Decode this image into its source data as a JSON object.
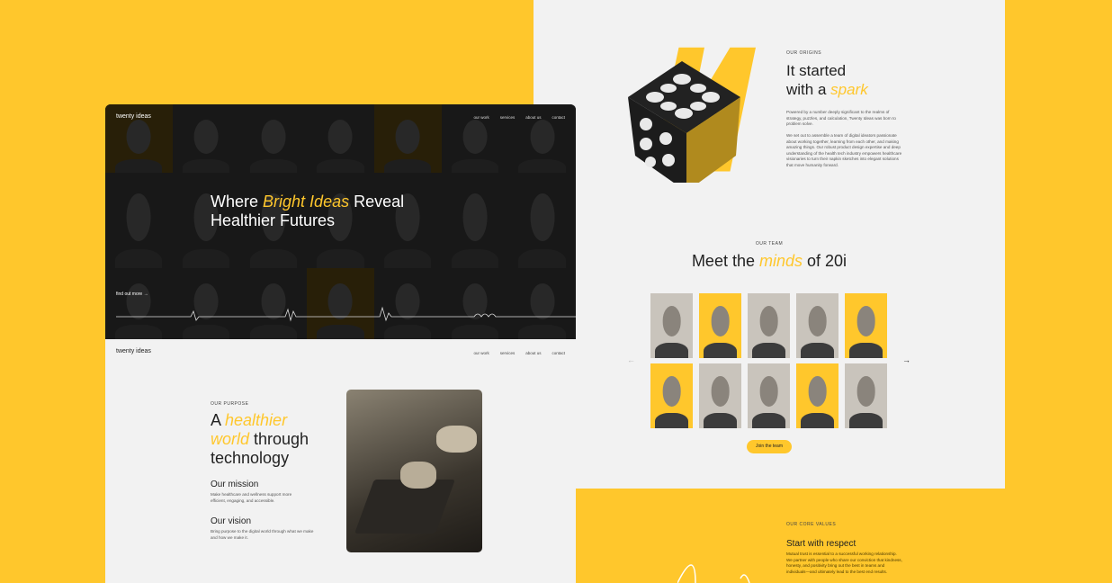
{
  "hero": {
    "logo": "twenty ideas",
    "nav": [
      "our work",
      "services",
      "about us",
      "contact"
    ],
    "title_pre": "Where ",
    "title_accent": "Bright Ideas",
    "title_post": " Reveal",
    "title_line2": "Healthier Futures",
    "cta": "find out more",
    "cta_icon": "arrow-right-icon"
  },
  "purpose": {
    "logo": "twenty ideas",
    "nav": [
      "our work",
      "services",
      "about us",
      "contact"
    ],
    "eyebrow": "OUR PURPOSE",
    "h_pre": "A ",
    "h_accent1": "healthier",
    "h_accent2": "world",
    "h_post": " through",
    "h_line3": "technology",
    "mission_title": "Our mission",
    "mission_text": "Make healthcare and wellness support more efficient, engaging, and accessible.",
    "vision_title": "Our vision",
    "vision_text": "Bring purpose to the digital world through what we make and how we make it."
  },
  "origins": {
    "eyebrow": "OUR ORIGINS",
    "h_line1": "It started",
    "h_pre": "with a ",
    "h_accent": "spark",
    "p1": "Powered by a number deeply significant to the realms of strategy, puzzles, and calculation, Twenty Ideas was born to problem solve.",
    "p2": "We set out to assemble a team of digital ideators passionate about working together, learning from each other, and making amazing things. Our robust product design expertise and deep understanding of the health tech industry empowers healthcare visionaries to turn their napkin sketches into elegant solutions that move humanity forward."
  },
  "team": {
    "eyebrow": "OUR TEAM",
    "h_pre": "Meet the ",
    "h_accent": "minds",
    "h_post": " of 20i",
    "prev_icon": "arrow-left-icon",
    "next_icon": "arrow-right-icon",
    "cta": "Join the team",
    "members_yellow": [
      false,
      true,
      false,
      false,
      true,
      true,
      false,
      false,
      true,
      false
    ]
  },
  "values": {
    "eyebrow": "OUR CORE VALUES",
    "title": "Start with respect",
    "text": "Mutual trust is essential to a successful working relationship. We partner with people who share our conviction that kindness, honesty, and positivity bring out the best in teams and individuals—and ultimately lead to the best end results."
  },
  "colors": {
    "accent": "#ffc72c",
    "dark": "#1a1a1a",
    "light": "#f2f2f2"
  }
}
